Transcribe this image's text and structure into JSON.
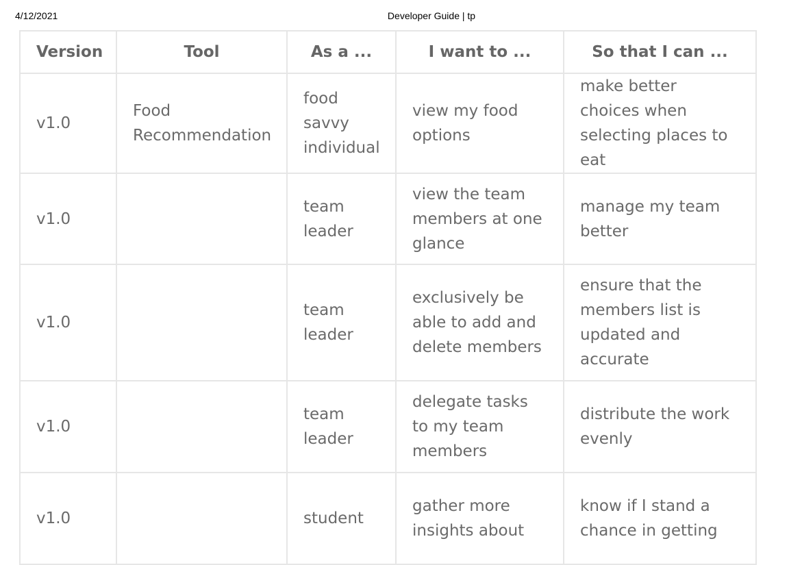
{
  "header": {
    "date": "4/12/2021",
    "title": "Developer Guide | tp"
  },
  "table": {
    "columns": [
      "Version",
      "Tool",
      "As a ...",
      "I want to ...",
      "So that I can ..."
    ],
    "rows": [
      {
        "version": "v1.0",
        "tool": "Food Recommendation",
        "as_a": "food savvy individual",
        "i_want_to": "view my food options",
        "so_that": "make better choices when selecting places to eat"
      },
      {
        "version": "v1.0",
        "tool": "",
        "as_a": "team leader",
        "i_want_to": "view the team members at one glance",
        "so_that": "manage my team better"
      },
      {
        "version": "v1.0",
        "tool": "",
        "as_a": "team leader",
        "i_want_to": "exclusively be able to add and delete members",
        "so_that": "ensure that the members list is updated and accurate"
      },
      {
        "version": "v1.0",
        "tool": "",
        "as_a": "team leader",
        "i_want_to": "delegate tasks to my team members",
        "so_that": "distribute the work evenly"
      },
      {
        "version": "v1.0",
        "tool": "",
        "as_a": "student",
        "i_want_to": "gather more insights about",
        "so_that": "know if I stand a chance in getting"
      }
    ]
  }
}
